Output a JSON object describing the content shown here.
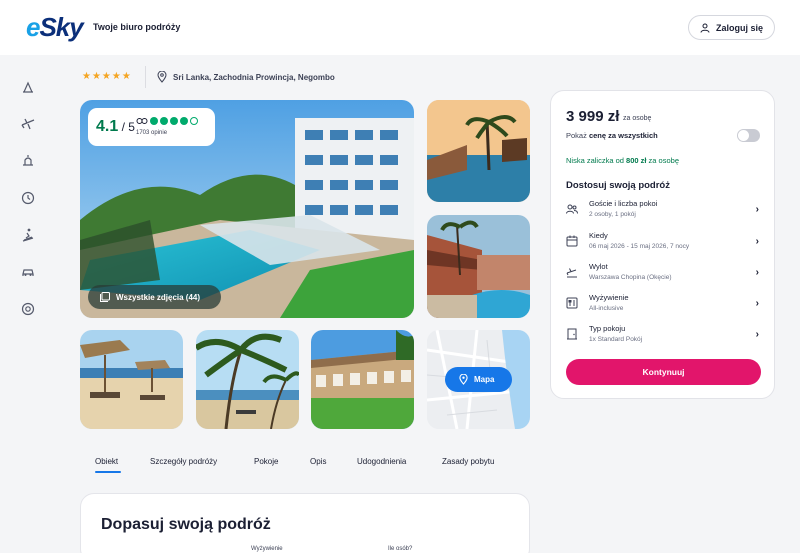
{
  "header": {
    "logo": "eSky",
    "tagline": "Twoje biuro podróży",
    "login_label": "Zaloguj się"
  },
  "sidebar": {
    "icons": [
      "beach-icon",
      "plane-icon",
      "last-minute-icon",
      "clock-icon",
      "ski-icon",
      "car-icon",
      "support-icon"
    ]
  },
  "hotel": {
    "stars": "★★★★★",
    "location": "Sri Lanka, Zachodnia Prowincja, Negombo",
    "rating": {
      "score": "4.1",
      "scale": " / 5",
      "reviews": "1703 opinie",
      "dots_filled": 4,
      "dots_total": 5
    },
    "all_photos_label": "Wszystkie zdjęcia (44)",
    "map_label": "Mapa"
  },
  "tabs": [
    {
      "label": "Obiekt",
      "active": true
    },
    {
      "label": "Szczegóły podróży",
      "active": false
    },
    {
      "label": "Pokoje",
      "active": false
    },
    {
      "label": "Opis",
      "active": false
    },
    {
      "label": "Udogodnienia",
      "active": false
    },
    {
      "label": "Zasady pobytu",
      "active": false
    }
  ],
  "adjust": {
    "title": "Dopasuj swoją podróż",
    "fields": [
      "Wyżywienie",
      "Ile osób?"
    ]
  },
  "booking": {
    "price": "3 999 zł",
    "per_person": "za osobę",
    "toggle_prefix": "Pokaż ",
    "toggle_bold": "cenę za wszystkich",
    "deposit_prefix": "Niska zaliczka od ",
    "deposit_amount": "800 zł",
    "deposit_suffix": " za osobę",
    "customize_title": "Dostosuj swoją podróż",
    "options": [
      {
        "title": "Goście i liczba pokoi",
        "value": "2 osoby, 1 pokój",
        "icon": "guests-icon"
      },
      {
        "title": "Kiedy",
        "value": "06 maj 2026 - 15 maj 2026, 7 nocy",
        "icon": "calendar-icon"
      },
      {
        "title": "Wylot",
        "value": "Warszawa Chopina (Okęcie)",
        "icon": "departure-icon"
      },
      {
        "title": "Wyżywienie",
        "value": "All-inclusive",
        "icon": "meal-icon"
      },
      {
        "title": "Typ pokoju",
        "value": "1x Standard Pokój",
        "icon": "room-icon"
      }
    ],
    "continue_label": "Kontynuuj"
  },
  "colors": {
    "brand_blue": "#0b2f7a",
    "accent_blue": "#1677e8",
    "cta_pink": "#e2156b",
    "tripadvisor_green": "#00aa6c",
    "star_orange": "#f4a523"
  }
}
